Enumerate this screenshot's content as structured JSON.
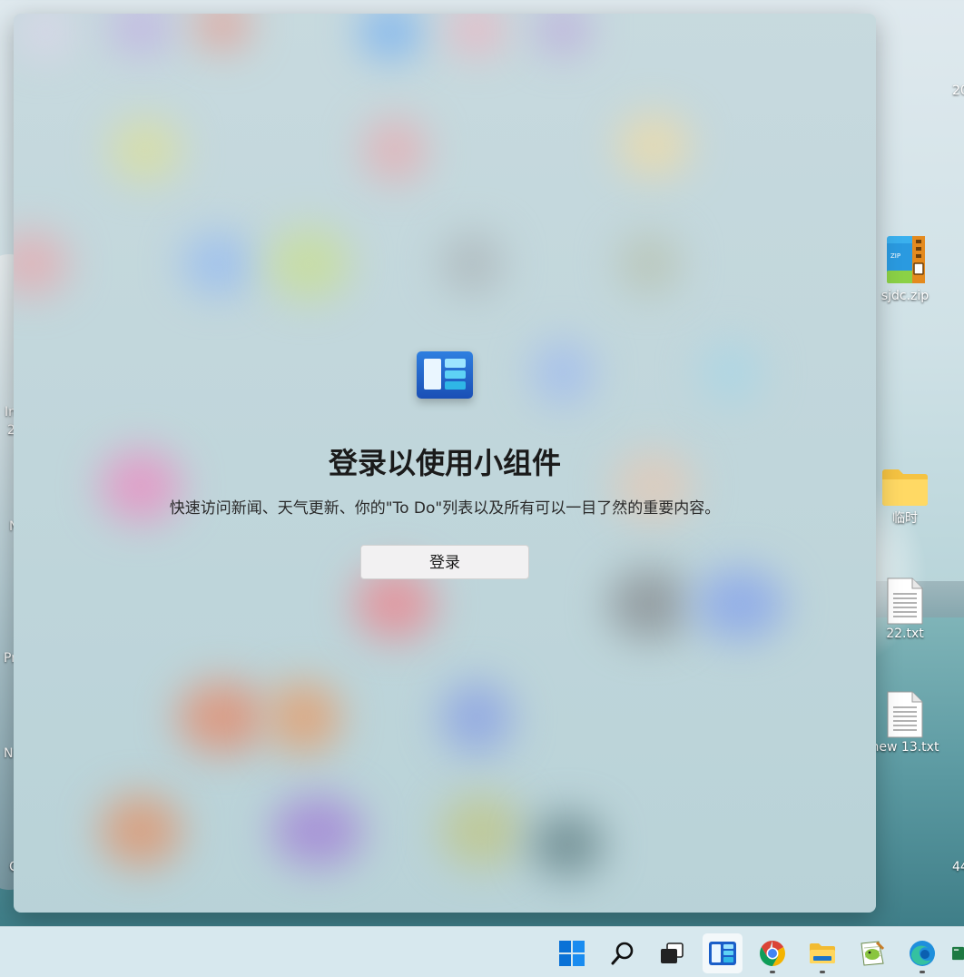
{
  "desktop": {
    "edge_fragments": [
      "In",
      "2",
      "N",
      "Pr",
      "N",
      "C",
      "20",
      "44"
    ],
    "icons": [
      {
        "label": "sjdc.zip",
        "icon": "zip-archive-icon"
      },
      {
        "label": "临时",
        "icon": "folder-icon"
      },
      {
        "label": "22.txt",
        "icon": "text-file-icon"
      },
      {
        "label": "new 13.txt",
        "icon": "text-file-icon"
      }
    ]
  },
  "widgets_panel": {
    "logo_icon": "widgets-icon",
    "title": "登录以使用小组件",
    "description": "快速访问新闻、天气更新、你的\"To Do\"列表以及所有可以一目了然的重要内容。",
    "sign_in_label": "登录"
  },
  "taskbar": {
    "items": [
      {
        "name": "start",
        "icon": "windows-start-icon"
      },
      {
        "name": "search",
        "icon": "search-icon"
      },
      {
        "name": "task-view",
        "icon": "task-view-icon"
      },
      {
        "name": "widgets",
        "icon": "widgets-icon",
        "active": true
      },
      {
        "name": "chrome",
        "icon": "chrome-icon",
        "running": true
      },
      {
        "name": "file-explorer",
        "icon": "folder-icon",
        "running": true
      },
      {
        "name": "notepad-plus",
        "icon": "notepad-plus-icon"
      },
      {
        "name": "edge",
        "icon": "edge-icon",
        "running": true
      },
      {
        "name": "excel",
        "icon": "excel-icon"
      }
    ]
  },
  "colors": {
    "accent": "#0067c0",
    "taskbar": "#d7e8ee",
    "logo_blue": "#1a4fb5"
  }
}
